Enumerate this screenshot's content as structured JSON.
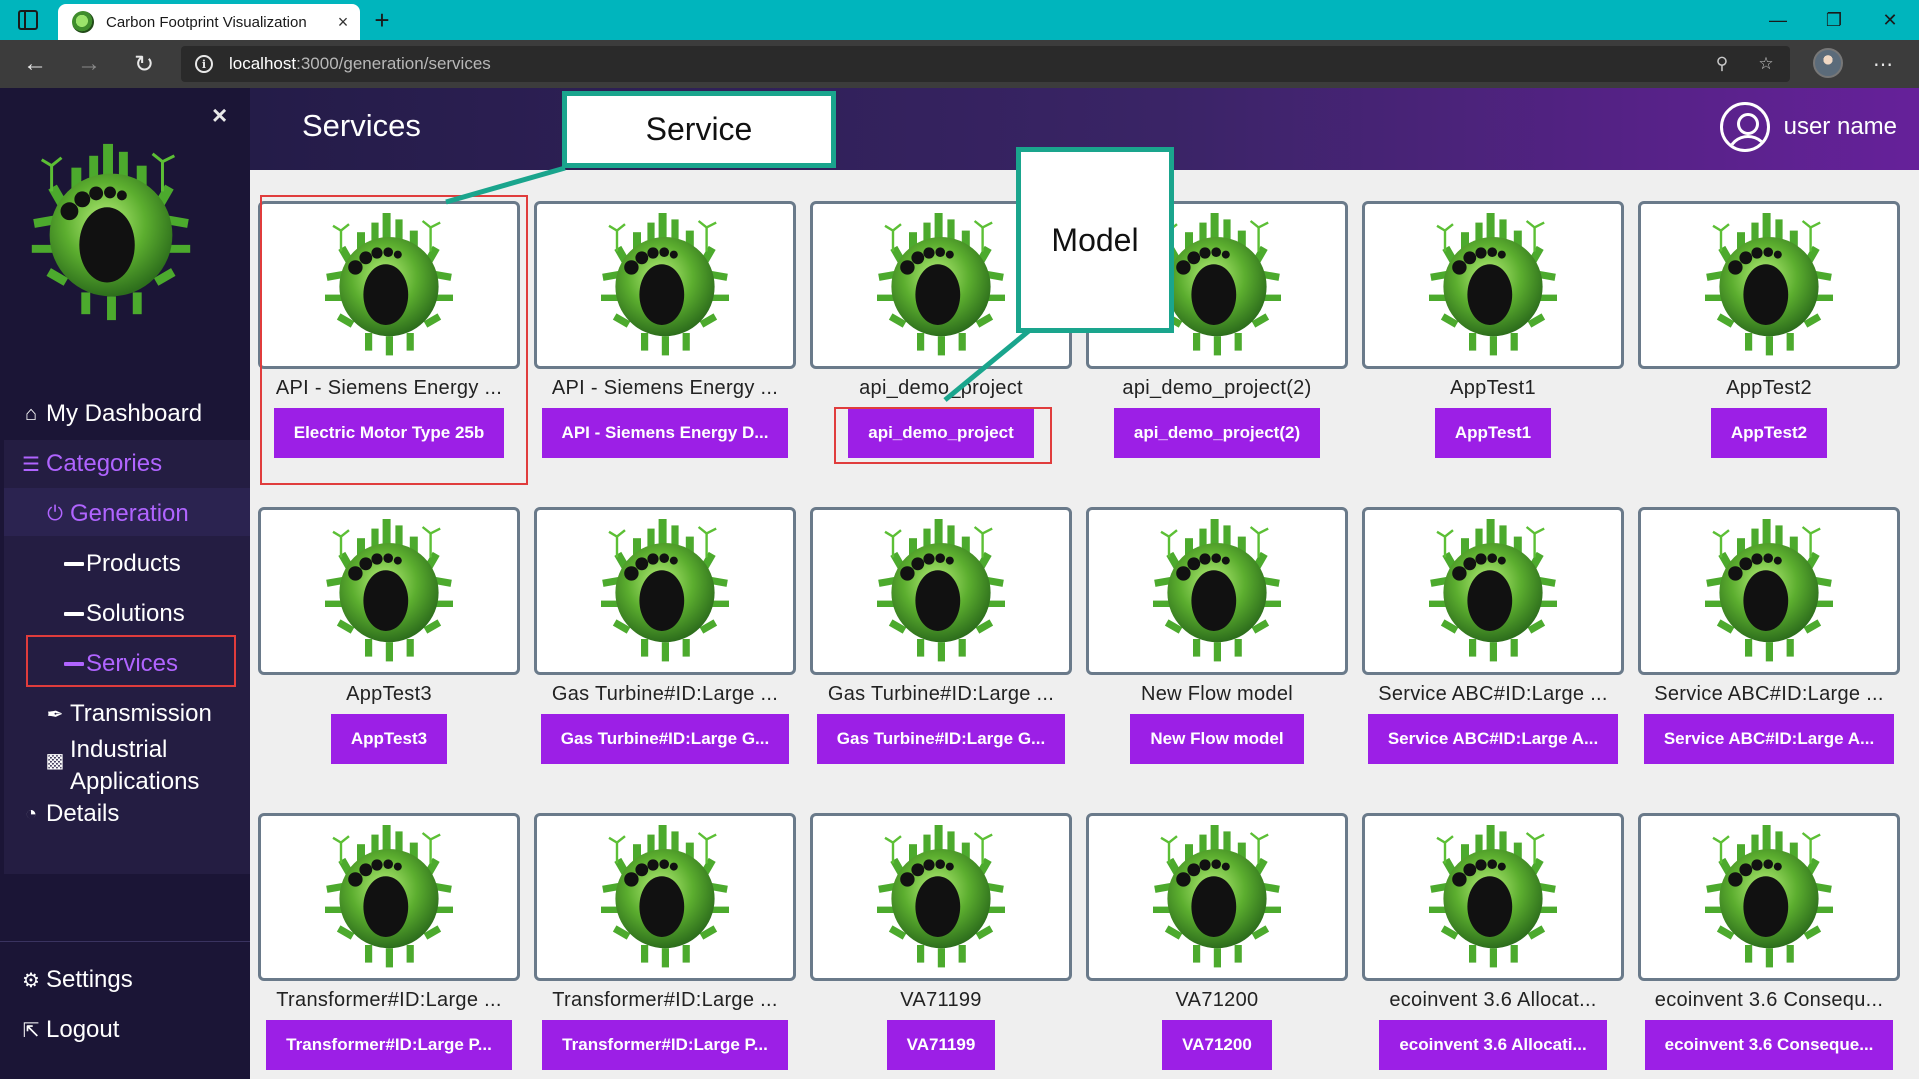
{
  "browser": {
    "tab_title": "Carbon Footprint Visualization",
    "tab_close": "×",
    "new_tab": "+",
    "url_host": "localhost",
    "url_path": ":3000/generation/services",
    "window_controls": [
      "—",
      "❐",
      "✕"
    ]
  },
  "sidebar": {
    "close": "×",
    "items": {
      "dashboard": "My Dashboard",
      "categories": "Categories",
      "generation": "Generation",
      "products": "Products",
      "solutions": "Solutions",
      "services": "Services",
      "transmission": "Transmission",
      "industrial_1": "Industrial",
      "industrial_2": "Applications",
      "details": "Details",
      "settings": "Settings",
      "logout": "Logout"
    }
  },
  "header": {
    "title": "Services",
    "user": "user name"
  },
  "annotations": {
    "service": "Service",
    "model": "Model"
  },
  "cards": [
    {
      "name": "API - Siemens Energy ...",
      "button": "Electric Motor Type 25b"
    },
    {
      "name": "API - Siemens Energy ...",
      "button": "API - Siemens Energy D..."
    },
    {
      "name": "api_demo_project",
      "button": "api_demo_project"
    },
    {
      "name": "api_demo_project(2)",
      "button": "api_demo_project(2)"
    },
    {
      "name": "AppTest1",
      "button": "AppTest1"
    },
    {
      "name": "AppTest2",
      "button": "AppTest2"
    },
    {
      "name": "AppTest3",
      "button": "AppTest3"
    },
    {
      "name": "Gas Turbine#ID:Large ...",
      "button": "Gas Turbine#ID:Large G..."
    },
    {
      "name": "Gas Turbine#ID:Large ...",
      "button": "Gas Turbine#ID:Large G..."
    },
    {
      "name": "New Flow model",
      "button": "New Flow model"
    },
    {
      "name": "Service ABC#ID:Large ...",
      "button": "Service ABC#ID:Large A..."
    },
    {
      "name": "Service ABC#ID:Large ...",
      "button": "Service ABC#ID:Large A..."
    },
    {
      "name": "Transformer#ID:Large ...",
      "button": "Transformer#ID:Large P..."
    },
    {
      "name": "Transformer#ID:Large ...",
      "button": "Transformer#ID:Large P..."
    },
    {
      "name": "VA71199",
      "button": "VA71199"
    },
    {
      "name": "VA71200",
      "button": "VA71200"
    },
    {
      "name": "ecoinvent 3.6 Allocat...",
      "button": "ecoinvent 3.6 Allocati..."
    },
    {
      "name": "ecoinvent 3.6 Consequ...",
      "button": "ecoinvent 3.6 Conseque..."
    }
  ],
  "colors": {
    "titlebar": "#00b5bd",
    "sidebar": "#1b1536",
    "accent": "#9c1fe6",
    "sidebar_active": "#b064ff",
    "callout_border": "#1aa58d",
    "highlight_red": "#e03c3c"
  }
}
